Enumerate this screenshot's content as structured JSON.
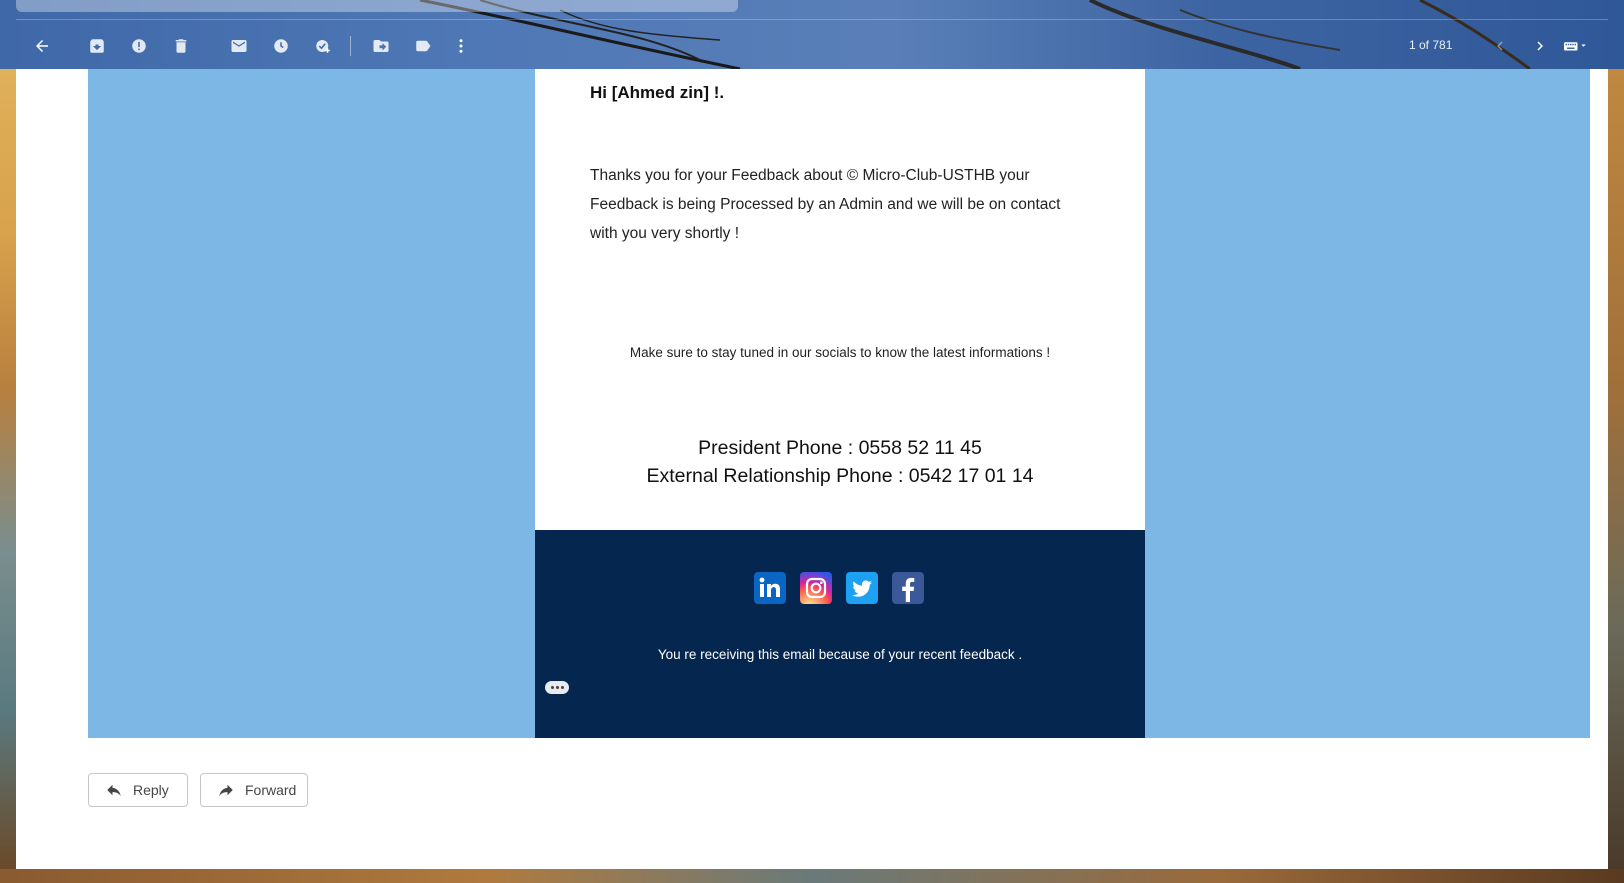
{
  "toolbar": {
    "page_count": "1 of 781",
    "icons": [
      "back-arrow-icon",
      "archive-icon",
      "report-spam-icon",
      "delete-icon",
      "mark-unread-icon",
      "snooze-icon",
      "add-to-tasks-icon",
      "move-to-icon",
      "label-icon",
      "more-vert-icon",
      "chevron-left-icon",
      "chevron-right-icon",
      "keyboard-icon"
    ]
  },
  "email": {
    "greeting": "Hi [Ahmed zin] !.",
    "body": "Thanks you for your Feedback about © Micro-Club-USTHB your Feedback is being Processed by an Admin and we will be on contact with you very shortly !",
    "stay_tuned": "Make sure to stay tuned in our socials to know the latest informations !",
    "president_phone": "President Phone : 0558 52 11 45",
    "external_phone": "External Relationship Phone : 0542 17 01 14",
    "footer_note": "You re receiving this email because of your recent feedback .",
    "socials": [
      "linkedin-icon",
      "instagram-icon",
      "twitter-icon",
      "facebook-icon"
    ]
  },
  "actions": {
    "reply_label": "Reply",
    "forward_label": "Forward"
  },
  "colors": {
    "email_background": "#7db7e6",
    "footer_background": "#05264e"
  }
}
